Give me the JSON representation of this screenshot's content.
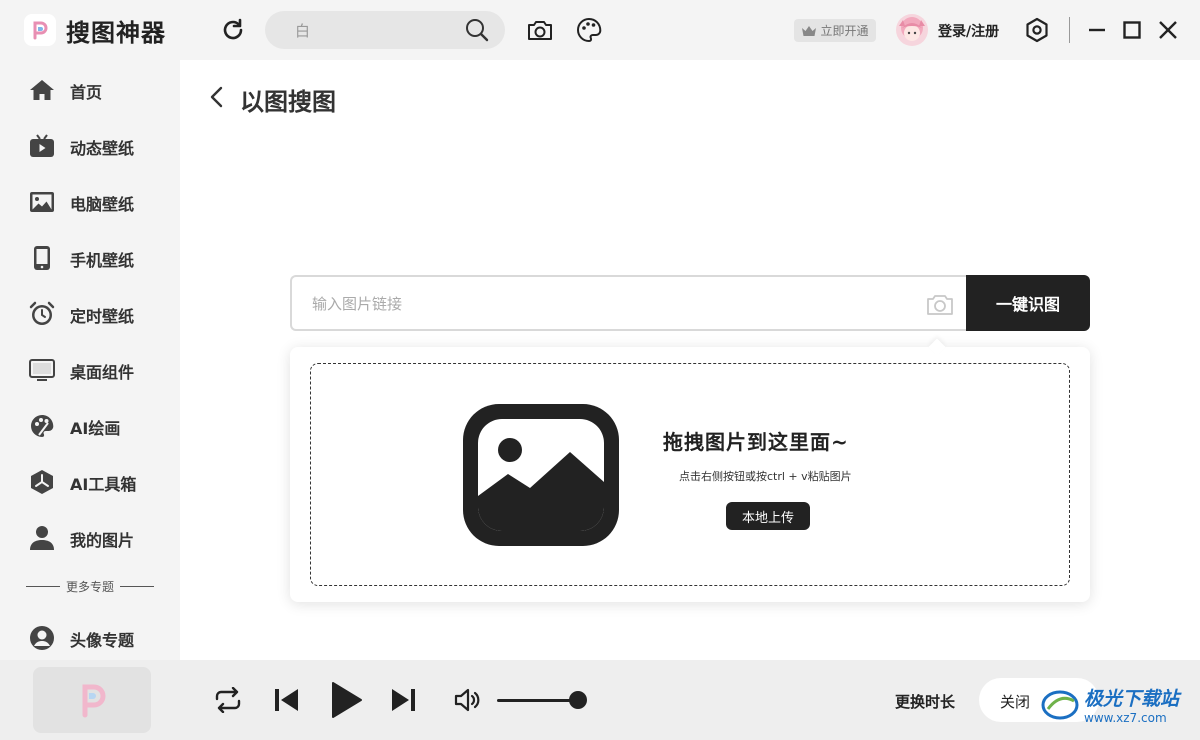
{
  "app": {
    "title": "搜图神器"
  },
  "titlebar": {
    "search_value": "白",
    "vip_label": "立即开通",
    "login_label": "登录/注册"
  },
  "sidebar": {
    "items": [
      {
        "label": "首页",
        "icon": "home-icon"
      },
      {
        "label": "动态壁纸",
        "icon": "tv-icon"
      },
      {
        "label": "电脑壁纸",
        "icon": "image-icon"
      },
      {
        "label": "手机壁纸",
        "icon": "phone-icon"
      },
      {
        "label": "定时壁纸",
        "icon": "alarm-clock-icon"
      },
      {
        "label": "桌面组件",
        "icon": "monitor-icon"
      },
      {
        "label": "AI绘画",
        "icon": "palette-icon"
      },
      {
        "label": "AI工具箱",
        "icon": "hexagon-tool-icon"
      },
      {
        "label": "我的图片",
        "icon": "user-icon"
      }
    ],
    "more_label": "更多专题",
    "extra_items": [
      {
        "label": "头像专题",
        "icon": "avatar-circle-icon"
      }
    ]
  },
  "main": {
    "title": "以图搜图",
    "url_placeholder": "输入图片链接",
    "identify_label": "一键识图",
    "drop_title": "拖拽图片到这里面~",
    "drop_hint": "点击右侧按钮或按ctrl + v粘贴图片",
    "upload_label": "本地上传"
  },
  "player": {
    "change_duration_label": "更换时长",
    "duration_value": "关闭",
    "volume_percent": 88
  },
  "watermark": {
    "brand": "极光下载站",
    "url": "www.xz7.com"
  },
  "colors": {
    "accent": "#222222",
    "background": "#f4f4f4",
    "content_bg": "#ffffff",
    "watermark": "#1b6fc2"
  }
}
